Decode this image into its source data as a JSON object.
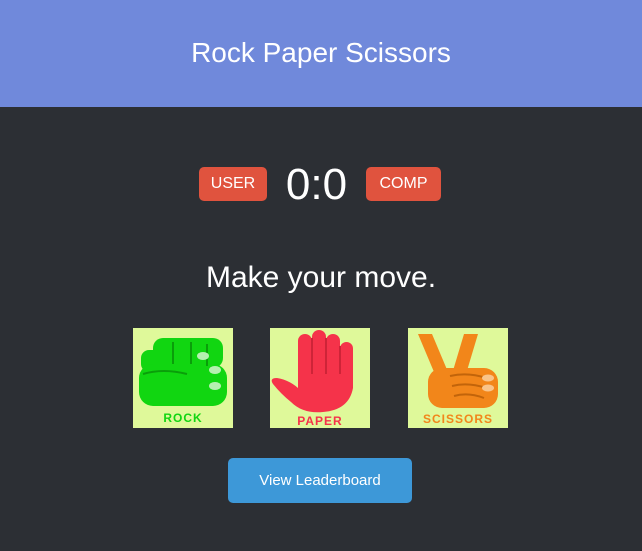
{
  "header": {
    "title": "Rock Paper Scissors"
  },
  "scoreboard": {
    "user_label": "USER",
    "score": "0:0",
    "comp_label": "COMP"
  },
  "prompt": "Make your move.",
  "choices": [
    {
      "id": "rock",
      "label": "ROCK",
      "icon": "fist-icon",
      "color": "#11d611"
    },
    {
      "id": "paper",
      "label": "PAPER",
      "icon": "open-hand-icon",
      "color": "#f5334a"
    },
    {
      "id": "scissors",
      "label": "SCISSORS",
      "icon": "victory-hand-icon",
      "color": "#f2861a"
    }
  ],
  "leaderboard_button": "View Leaderboard",
  "colors": {
    "header_bg": "#7089db",
    "page_bg": "#2c2f34",
    "badge_bg": "#e0533e",
    "button_bg": "#3d98d8",
    "tile_bg": "#dff99a"
  }
}
